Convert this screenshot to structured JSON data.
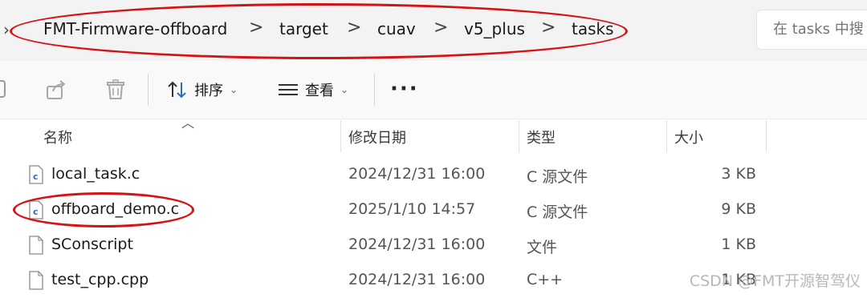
{
  "breadcrumb": {
    "items": [
      "FMT-Firmware-offboard",
      "target",
      "cuav",
      "v5_plus",
      "tasks"
    ],
    "separator": ">"
  },
  "search": {
    "placeholder": "在 tasks 中搜"
  },
  "toolbar": {
    "sort_label": "排序",
    "view_label": "查看",
    "more_label": "···"
  },
  "columns": {
    "name": "名称",
    "date": "修改日期",
    "type": "类型",
    "size": "大小"
  },
  "files": [
    {
      "name": "local_task.c",
      "date": "2024/12/31 16:00",
      "type": "C 源文件",
      "size": "3 KB",
      "icon": "c-file-icon"
    },
    {
      "name": "offboard_demo.c",
      "date": "2025/1/10 14:57",
      "type": "C 源文件",
      "size": "9 KB",
      "icon": "c-file-icon"
    },
    {
      "name": "SConscript",
      "date": "2024/12/31 16:00",
      "type": "文件",
      "size": "1 KB",
      "icon": "blank-file-icon"
    },
    {
      "name": "test_cpp.cpp",
      "date": "2024/12/31 16:00",
      "type": "C++",
      "size": "1 KB",
      "icon": "blank-file-icon"
    }
  ],
  "watermark": "CSDN @FMT开源智驾仪",
  "colors": {
    "highlight": "#d41414",
    "icon_blue": "#2b6cc4"
  }
}
